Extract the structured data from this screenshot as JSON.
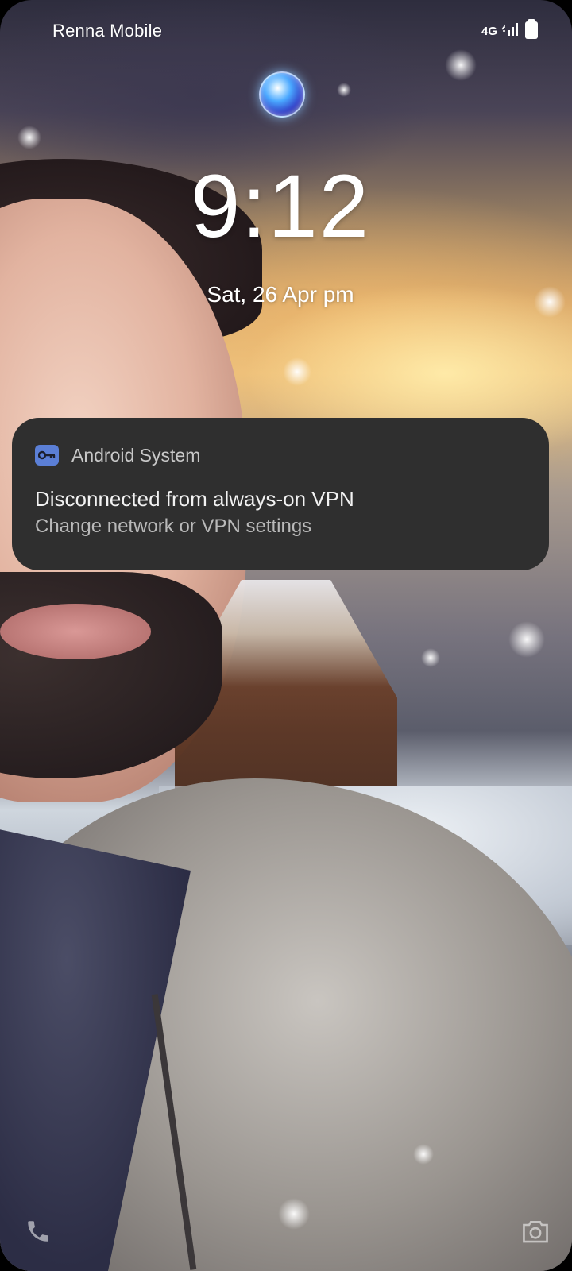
{
  "status_bar": {
    "carrier": "Renna Mobile",
    "network_type": "4G",
    "icons": [
      "signal-icon",
      "battery-icon"
    ]
  },
  "lock_screen": {
    "time": "9:12",
    "date": "Sat, 26 Apr  pm"
  },
  "notification": {
    "app_icon": "vpn-key-icon",
    "app_name": "Android System",
    "title": "Disconnected from always-on VPN",
    "body": "Change network or VPN settings"
  },
  "shortcuts": {
    "left_icon": "phone-icon",
    "right_icon": "camera-icon"
  },
  "colors": {
    "notification_bg": "#2f2f2f",
    "app_icon_bg": "#5b7fd6"
  }
}
